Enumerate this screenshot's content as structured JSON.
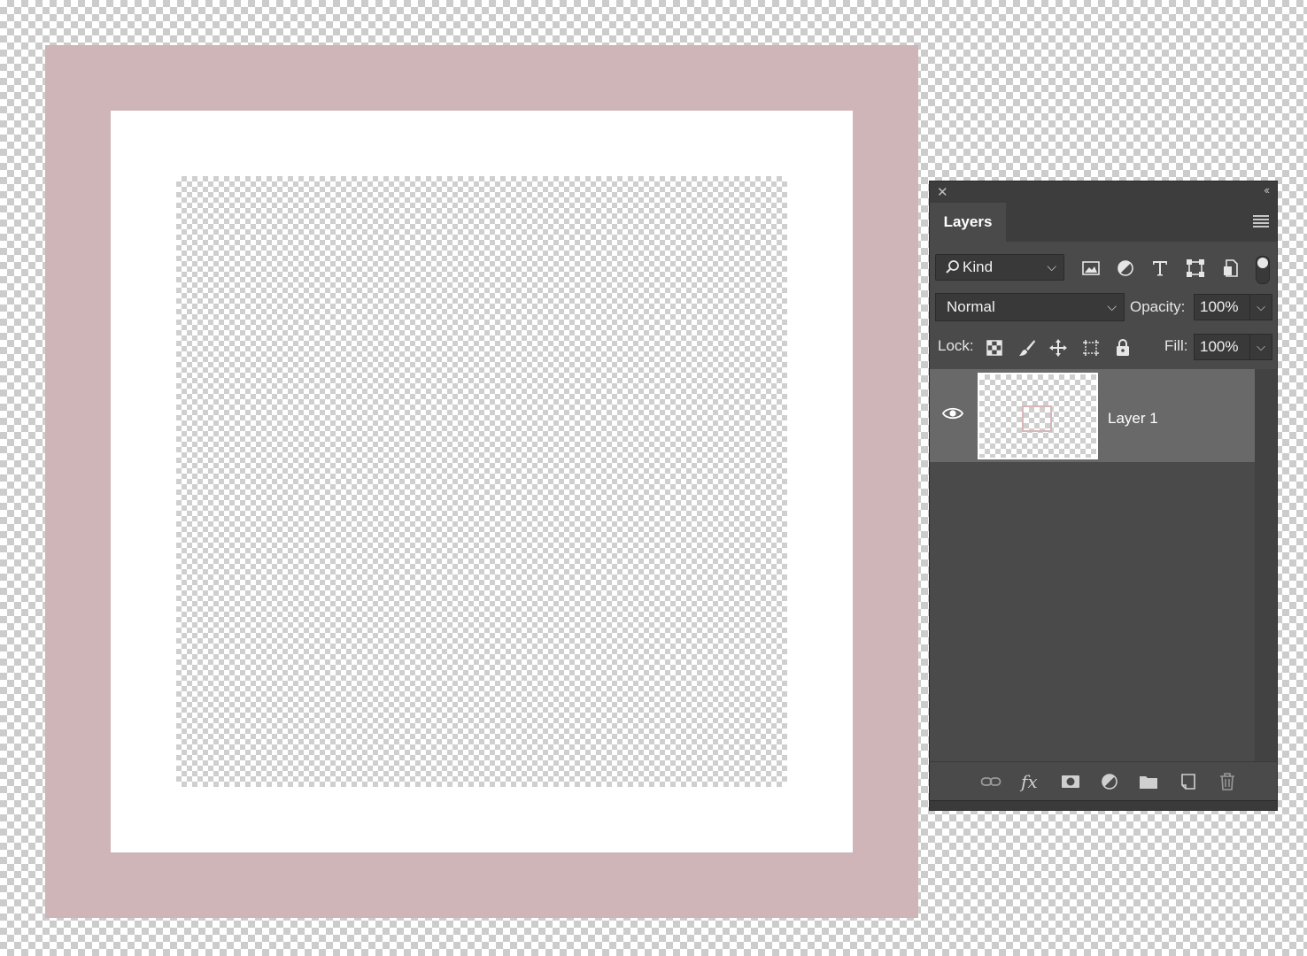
{
  "canvas": {
    "frame_colors": {
      "outer": "#cfb5b7",
      "middle": "#ffffff"
    }
  },
  "panel": {
    "close_icon": "✕",
    "collapse_icon": "‹‹",
    "tab_label": "Layers",
    "filter": {
      "kind_label": "Kind",
      "kind_icon": "search-icon"
    },
    "blend_mode": "Normal",
    "opacity_label": "Opacity:",
    "opacity_value": "100%",
    "lock_label": "Lock:",
    "fill_label": "Fill:",
    "fill_value": "100%",
    "layers": [
      {
        "name": "Layer 1",
        "visible": true,
        "selected": true,
        "thumb_accent": "#d8b7ba"
      }
    ]
  }
}
